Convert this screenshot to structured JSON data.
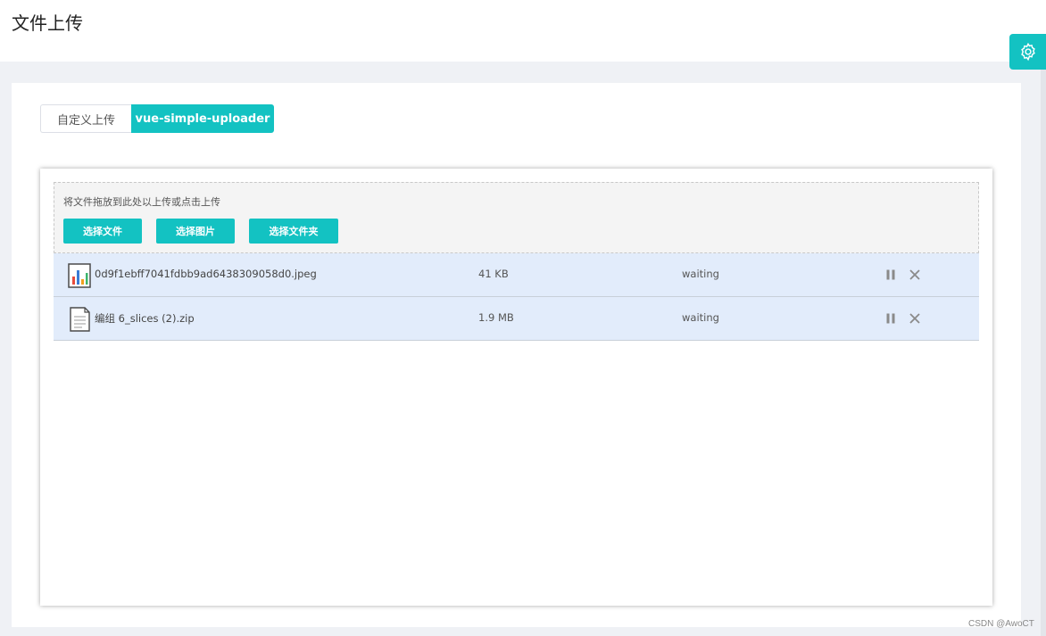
{
  "header": {
    "title": "文件上传"
  },
  "settings": {
    "icon": "gear-icon"
  },
  "tabs": [
    {
      "label": "自定义上传",
      "active": false
    },
    {
      "label": "vue-simple-uploader",
      "active": true
    }
  ],
  "uploader": {
    "drop_hint": "将文件拖放到此处以上传或点击上传",
    "buttons": {
      "select_file": "选择文件",
      "select_image": "选择图片",
      "select_folder": "选择文件夹"
    },
    "files": [
      {
        "icon": "image-file-icon",
        "name": "0d9f1ebff7041fdbb9ad6438309058d0.jpeg",
        "size": "41 KB",
        "status": "waiting"
      },
      {
        "icon": "zip-file-icon",
        "name": "编组 6_slices (2).zip",
        "size": "1.9 MB",
        "status": "waiting"
      }
    ]
  },
  "watermark": "CSDN @AwoCT",
  "colors": {
    "accent": "#13c2c2",
    "row_bg": "#e2ecfb",
    "page_bg": "#eff1f5"
  }
}
